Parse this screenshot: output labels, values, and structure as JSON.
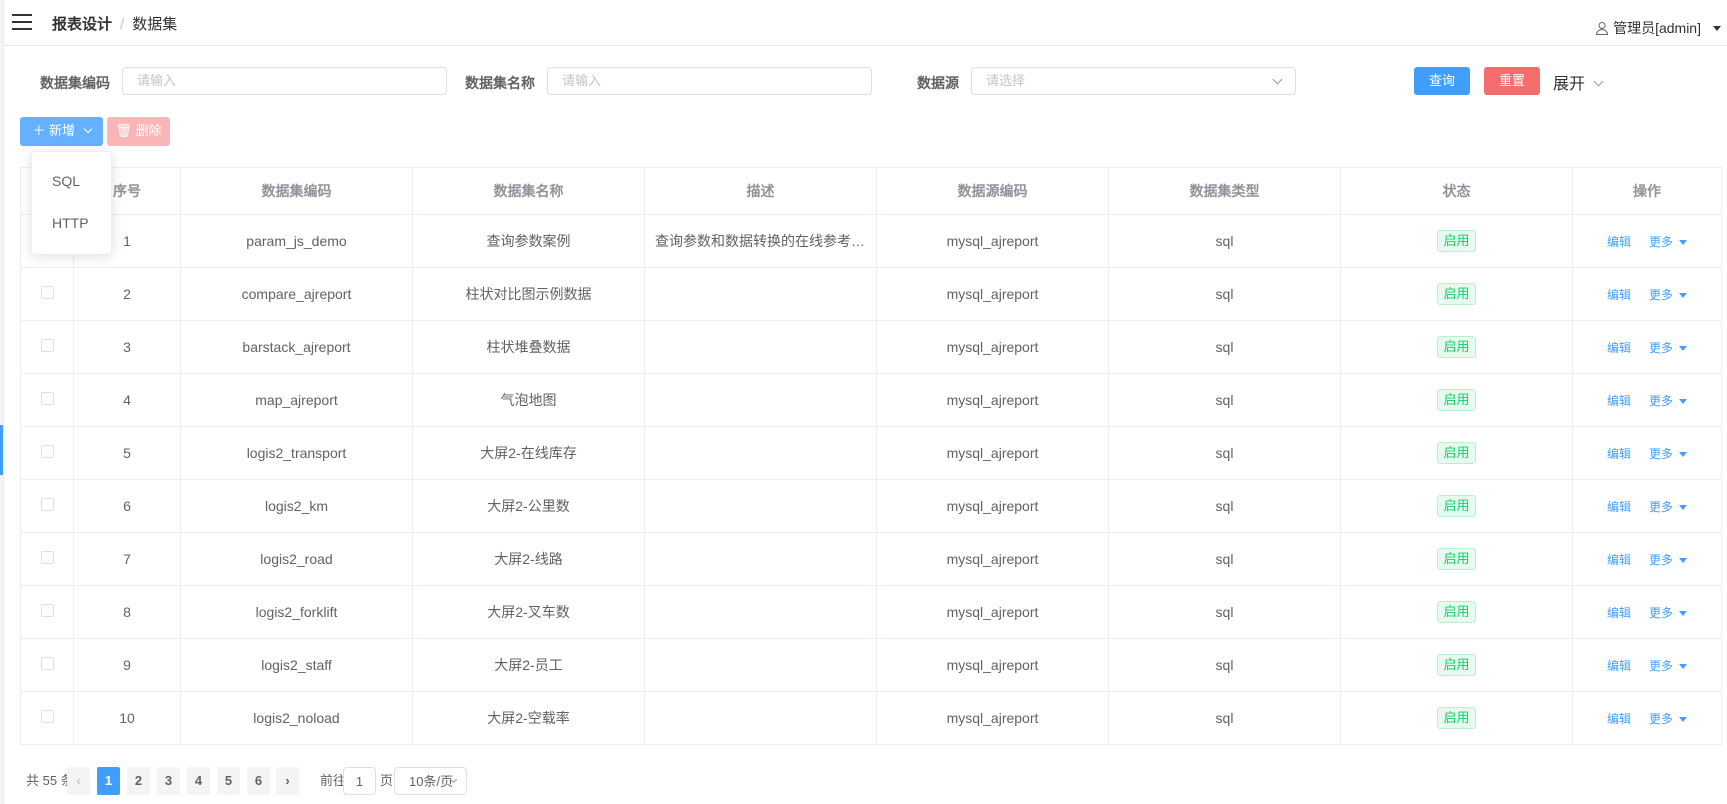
{
  "header": {
    "breadcrumb": [
      "报表设计",
      "数据集"
    ],
    "user": "管理员[admin]"
  },
  "filters": {
    "code_label": "数据集编码",
    "code_placeholder": "请输入",
    "name_label": "数据集名称",
    "name_placeholder": "请输入",
    "source_label": "数据源",
    "source_placeholder": "请选择",
    "query": "查询",
    "reset": "重置",
    "expand": "展开"
  },
  "toolbar": {
    "add": "新增",
    "delete": "删除",
    "add_menu": [
      "SQL",
      "HTTP"
    ]
  },
  "colors": {
    "primary": "#409eff",
    "danger": "#f56c6c",
    "success": "#13ce66"
  },
  "table": {
    "columns": [
      "序号",
      "数据集编码",
      "数据集名称",
      "描述",
      "数据源编码",
      "数据集类型",
      "状态",
      "操作"
    ],
    "rows": [
      {
        "no": "1",
        "code": "param_js_demo",
        "name": "查询参数案例",
        "desc": "查询参数和数据转换的在线参考…",
        "source": "mysql_ajreport",
        "type": "sql",
        "status": "启用"
      },
      {
        "no": "2",
        "code": "compare_ajreport",
        "name": "柱状对比图示例数据",
        "desc": "",
        "source": "mysql_ajreport",
        "type": "sql",
        "status": "启用"
      },
      {
        "no": "3",
        "code": "barstack_ajreport",
        "name": "柱状堆叠数据",
        "desc": "",
        "source": "mysql_ajreport",
        "type": "sql",
        "status": "启用"
      },
      {
        "no": "4",
        "code": "map_ajreport",
        "name": "气泡地图",
        "desc": "",
        "source": "mysql_ajreport",
        "type": "sql",
        "status": "启用"
      },
      {
        "no": "5",
        "code": "logis2_transport",
        "name": "大屏2-在线库存",
        "desc": "",
        "source": "mysql_ajreport",
        "type": "sql",
        "status": "启用"
      },
      {
        "no": "6",
        "code": "logis2_km",
        "name": "大屏2-公里数",
        "desc": "",
        "source": "mysql_ajreport",
        "type": "sql",
        "status": "启用"
      },
      {
        "no": "7",
        "code": "logis2_road",
        "name": "大屏2-线路",
        "desc": "",
        "source": "mysql_ajreport",
        "type": "sql",
        "status": "启用"
      },
      {
        "no": "8",
        "code": "logis2_forklift",
        "name": "大屏2-叉车数",
        "desc": "",
        "source": "mysql_ajreport",
        "type": "sql",
        "status": "启用"
      },
      {
        "no": "9",
        "code": "logis2_staff",
        "name": "大屏2-员工",
        "desc": "",
        "source": "mysql_ajreport",
        "type": "sql",
        "status": "启用"
      },
      {
        "no": "10",
        "code": "logis2_noload",
        "name": "大屏2-空载率",
        "desc": "",
        "source": "mysql_ajreport",
        "type": "sql",
        "status": "启用"
      }
    ],
    "edit": "编辑",
    "more": "更多"
  },
  "pagination": {
    "total": "共 55 条",
    "pages": [
      "1",
      "2",
      "3",
      "4",
      "5",
      "6"
    ],
    "current": "1",
    "goto_prefix": "前往",
    "goto_value": "1",
    "goto_suffix": "页",
    "page_size": "10条/页"
  }
}
